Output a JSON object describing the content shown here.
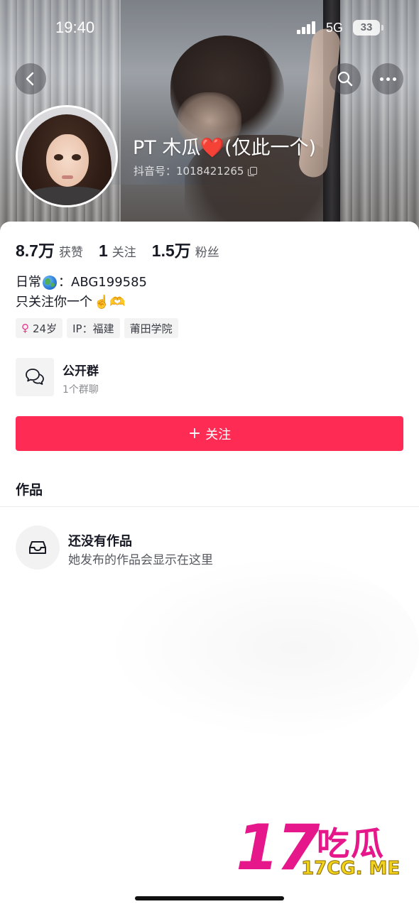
{
  "status_bar": {
    "time": "19:40",
    "network": "5G",
    "battery": "33"
  },
  "nav": {
    "back_icon": "chevron-left-icon",
    "search_icon": "search-icon",
    "more_icon": "more-dots-icon"
  },
  "profile": {
    "name_prefix": "PT 木瓜",
    "name_emoji": "❤️",
    "name_suffix": "(仅此一个)",
    "douyin_id_label": "抖音号：",
    "douyin_id": "1018421265"
  },
  "stats": [
    {
      "value": "8.7万",
      "label": "获赞"
    },
    {
      "value": "1",
      "label": "关注"
    },
    {
      "value": "1.5万",
      "label": "粉丝"
    }
  ],
  "bio": {
    "line1_prefix": "日常",
    "line1_suffix": "：ABG199585",
    "line2_text": "只关注你一个",
    "line2_emoji": "☝️🫶"
  },
  "tags": {
    "age": "24岁",
    "ip": "IP：福建",
    "school": "莆田学院"
  },
  "group": {
    "title": "公开群",
    "subtitle": "1个群聊"
  },
  "follow_button": {
    "plus": "+",
    "label": "关注"
  },
  "works": {
    "section_title": "作品",
    "empty_title": "还没有作品",
    "empty_subtitle": "她发布的作品会显示在这里"
  },
  "watermark": {
    "number": "17",
    "chinese": "吃瓜",
    "url": "17CG. ME"
  },
  "colors": {
    "accent": "#fe2c55",
    "text_primary": "#161823",
    "text_secondary": "#575960",
    "watermark_pink": "#e6178a",
    "watermark_yellow": "#f2d31b"
  }
}
